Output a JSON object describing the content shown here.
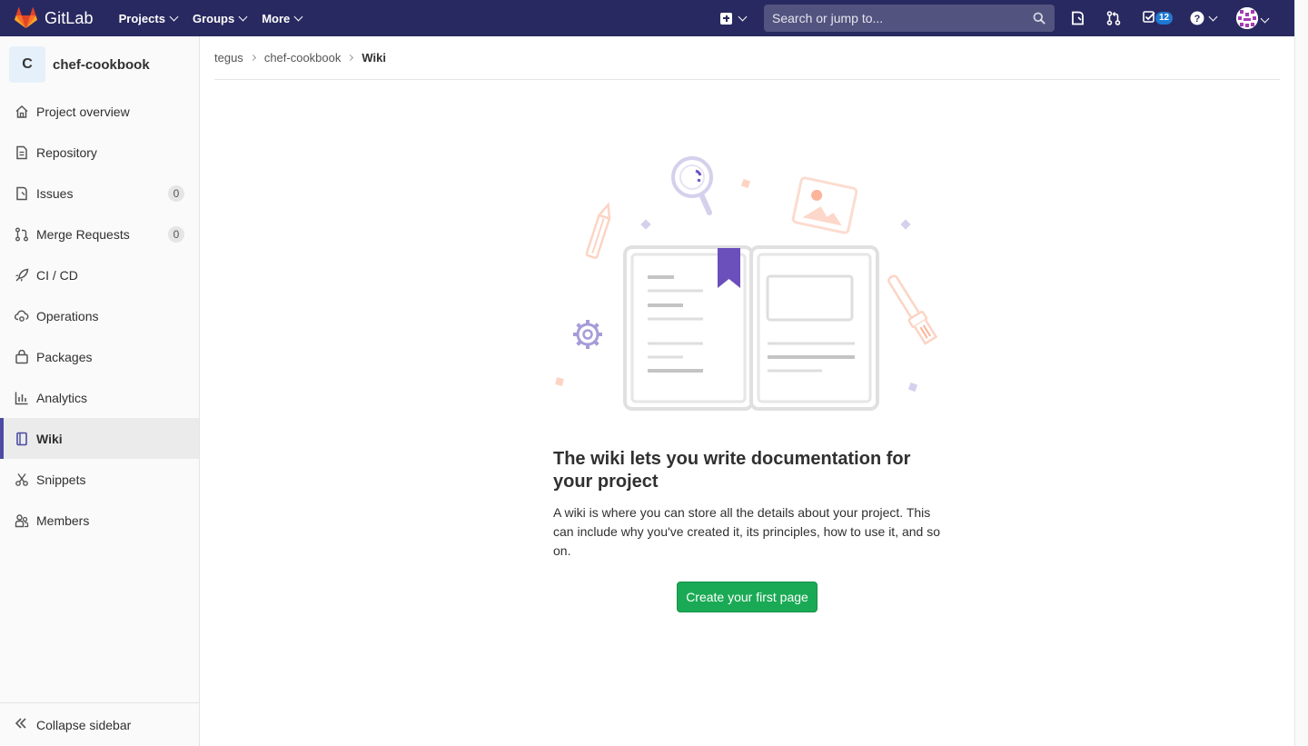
{
  "navbar": {
    "brand": "GitLab",
    "menu": [
      {
        "label": "Projects"
      },
      {
        "label": "Groups"
      },
      {
        "label": "More"
      }
    ],
    "search_placeholder": "Search or jump to...",
    "todo_count": "12",
    "colors": {
      "navbar_bg": "#292961",
      "badge": "#1f78d1"
    }
  },
  "sidebar": {
    "project_initial": "C",
    "project_name": "chef-cookbook",
    "items": [
      {
        "label": "Project overview",
        "icon": "home-icon"
      },
      {
        "label": "Repository",
        "icon": "doc-icon"
      },
      {
        "label": "Issues",
        "icon": "issues-icon",
        "count": "0"
      },
      {
        "label": "Merge Requests",
        "icon": "merge-request-icon",
        "count": "0"
      },
      {
        "label": "CI / CD",
        "icon": "rocket-icon"
      },
      {
        "label": "Operations",
        "icon": "cloud-gear-icon"
      },
      {
        "label": "Packages",
        "icon": "package-icon"
      },
      {
        "label": "Analytics",
        "icon": "chart-icon"
      },
      {
        "label": "Wiki",
        "icon": "book-icon",
        "active": true
      },
      {
        "label": "Snippets",
        "icon": "scissors-icon"
      },
      {
        "label": "Members",
        "icon": "users-icon"
      }
    ],
    "collapse_label": "Collapse sidebar"
  },
  "breadcrumb": {
    "items": [
      "tegus",
      "chef-cookbook"
    ],
    "current": "Wiki"
  },
  "empty_state": {
    "title": "The wiki lets you write documentation for your project",
    "description": "A wiki is where you can store all the details about your project. This can include why you've created it, its principles, how to use it, and so on.",
    "button": "Create your first page",
    "button_color": "#1aaa55"
  }
}
